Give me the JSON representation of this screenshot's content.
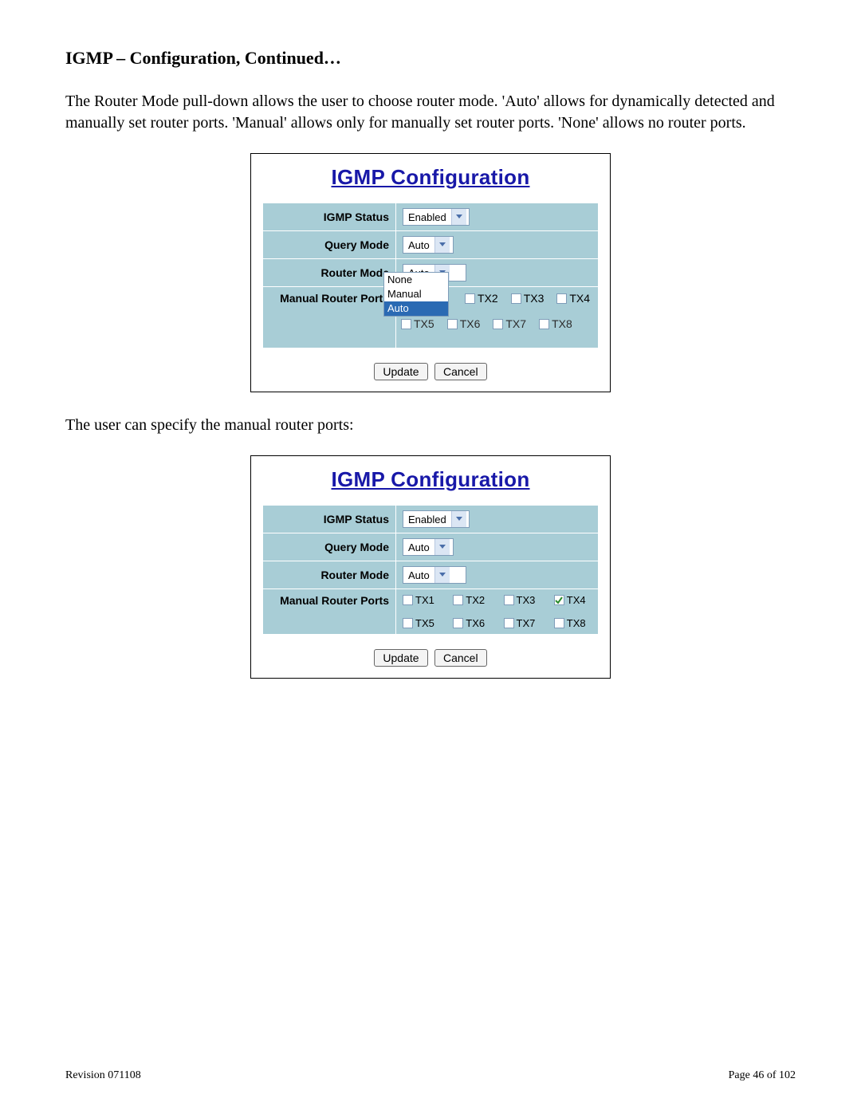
{
  "heading": "IGMP – Configuration, Continued…",
  "intro_paragraph": "The Router Mode pull-down allows the user to choose router mode.  'Auto' allows for dynamically detected and manually set router ports.  'Manual' allows only for manually set router ports.  'None' allows no router ports.",
  "panel1": {
    "title": "IGMP Configuration",
    "rows": {
      "igmp_status": {
        "label": "IGMP Status",
        "value": "Enabled"
      },
      "query_mode": {
        "label": "Query Mode",
        "value": "Auto"
      },
      "router_mode": {
        "label": "Router Mode",
        "value": "Auto",
        "options": [
          "None",
          "Manual",
          "Auto"
        ],
        "selected": "Auto"
      },
      "manual_ports": {
        "label": "Manual Router Ports"
      }
    },
    "ports_under": [
      "TX5",
      "TX6",
      "TX7",
      "TX8"
    ],
    "ports_over": [
      "TX2",
      "TX3",
      "TX4"
    ],
    "buttons": {
      "update": "Update",
      "cancel": "Cancel"
    }
  },
  "mid_paragraph": "The user can specify the manual router ports:",
  "panel2": {
    "title": "IGMP Configuration",
    "rows": {
      "igmp_status": {
        "label": "IGMP Status",
        "value": "Enabled"
      },
      "query_mode": {
        "label": "Query Mode",
        "value": "Auto"
      },
      "router_mode": {
        "label": "Router Mode",
        "value": "Auto"
      },
      "manual_ports": {
        "label": "Manual Router Ports"
      }
    },
    "ports": [
      {
        "name": "TX1",
        "checked": false
      },
      {
        "name": "TX2",
        "checked": false
      },
      {
        "name": "TX3",
        "checked": false
      },
      {
        "name": "TX4",
        "checked": true
      },
      {
        "name": "TX5",
        "checked": false
      },
      {
        "name": "TX6",
        "checked": false
      },
      {
        "name": "TX7",
        "checked": false
      },
      {
        "name": "TX8",
        "checked": false
      }
    ],
    "buttons": {
      "update": "Update",
      "cancel": "Cancel"
    }
  },
  "footer": {
    "revision": "Revision 071108",
    "page": "Page 46 of 102"
  }
}
